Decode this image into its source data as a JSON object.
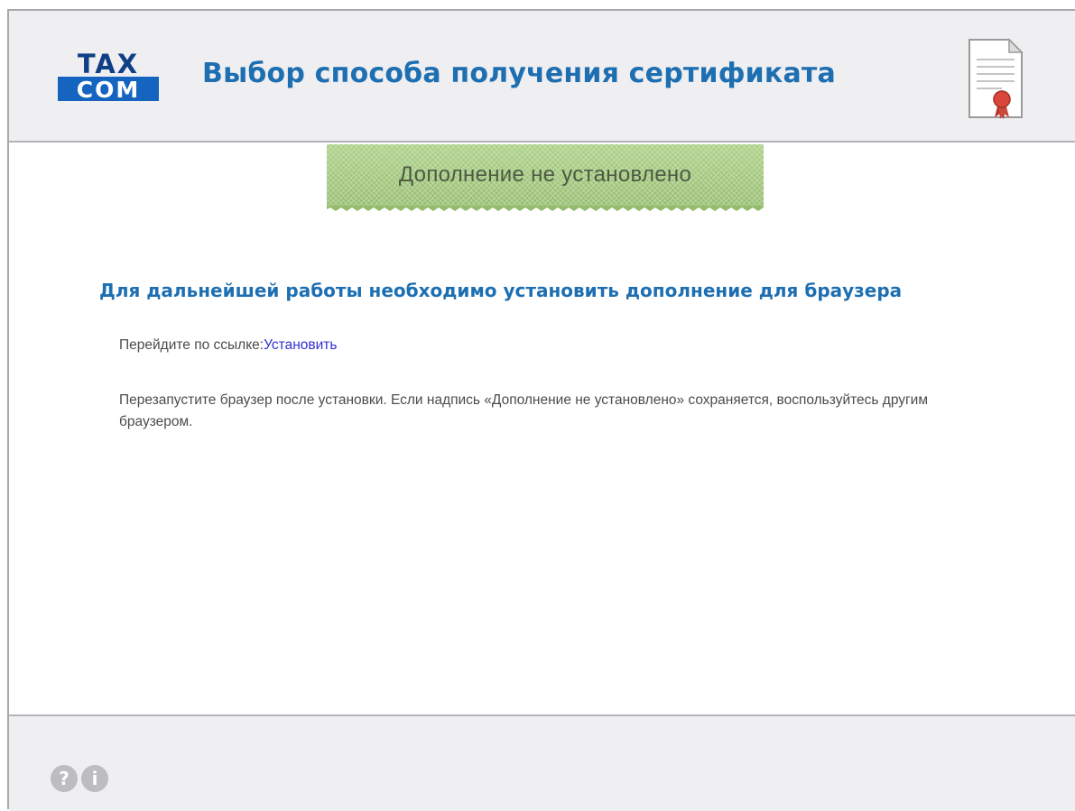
{
  "header": {
    "logo_top": "TAX",
    "logo_bottom": "COM",
    "title": "Выбор способа получения сертификата",
    "certificate_icon": "certificate-document-icon"
  },
  "status_banner": {
    "text": "Дополнение не установлено"
  },
  "notice": {
    "heading": "Для дальнейшей работы необходимо установить дополнение для браузера",
    "link_prompt": "Перейдите по ссылке:",
    "link_label": "Установить",
    "restart_text": "Перезапустите браузер после установки. Если надпись «Дополнение не установлено» сохраняется, воспользуйтесь другим браузером."
  },
  "footer": {
    "help_icon": "?",
    "info_icon": "i"
  },
  "colors": {
    "brand_blue": "#1d6fb2",
    "banner_green": "#9fc67a",
    "link_blue": "#3131d1",
    "panel_gray": "#efeef1"
  }
}
